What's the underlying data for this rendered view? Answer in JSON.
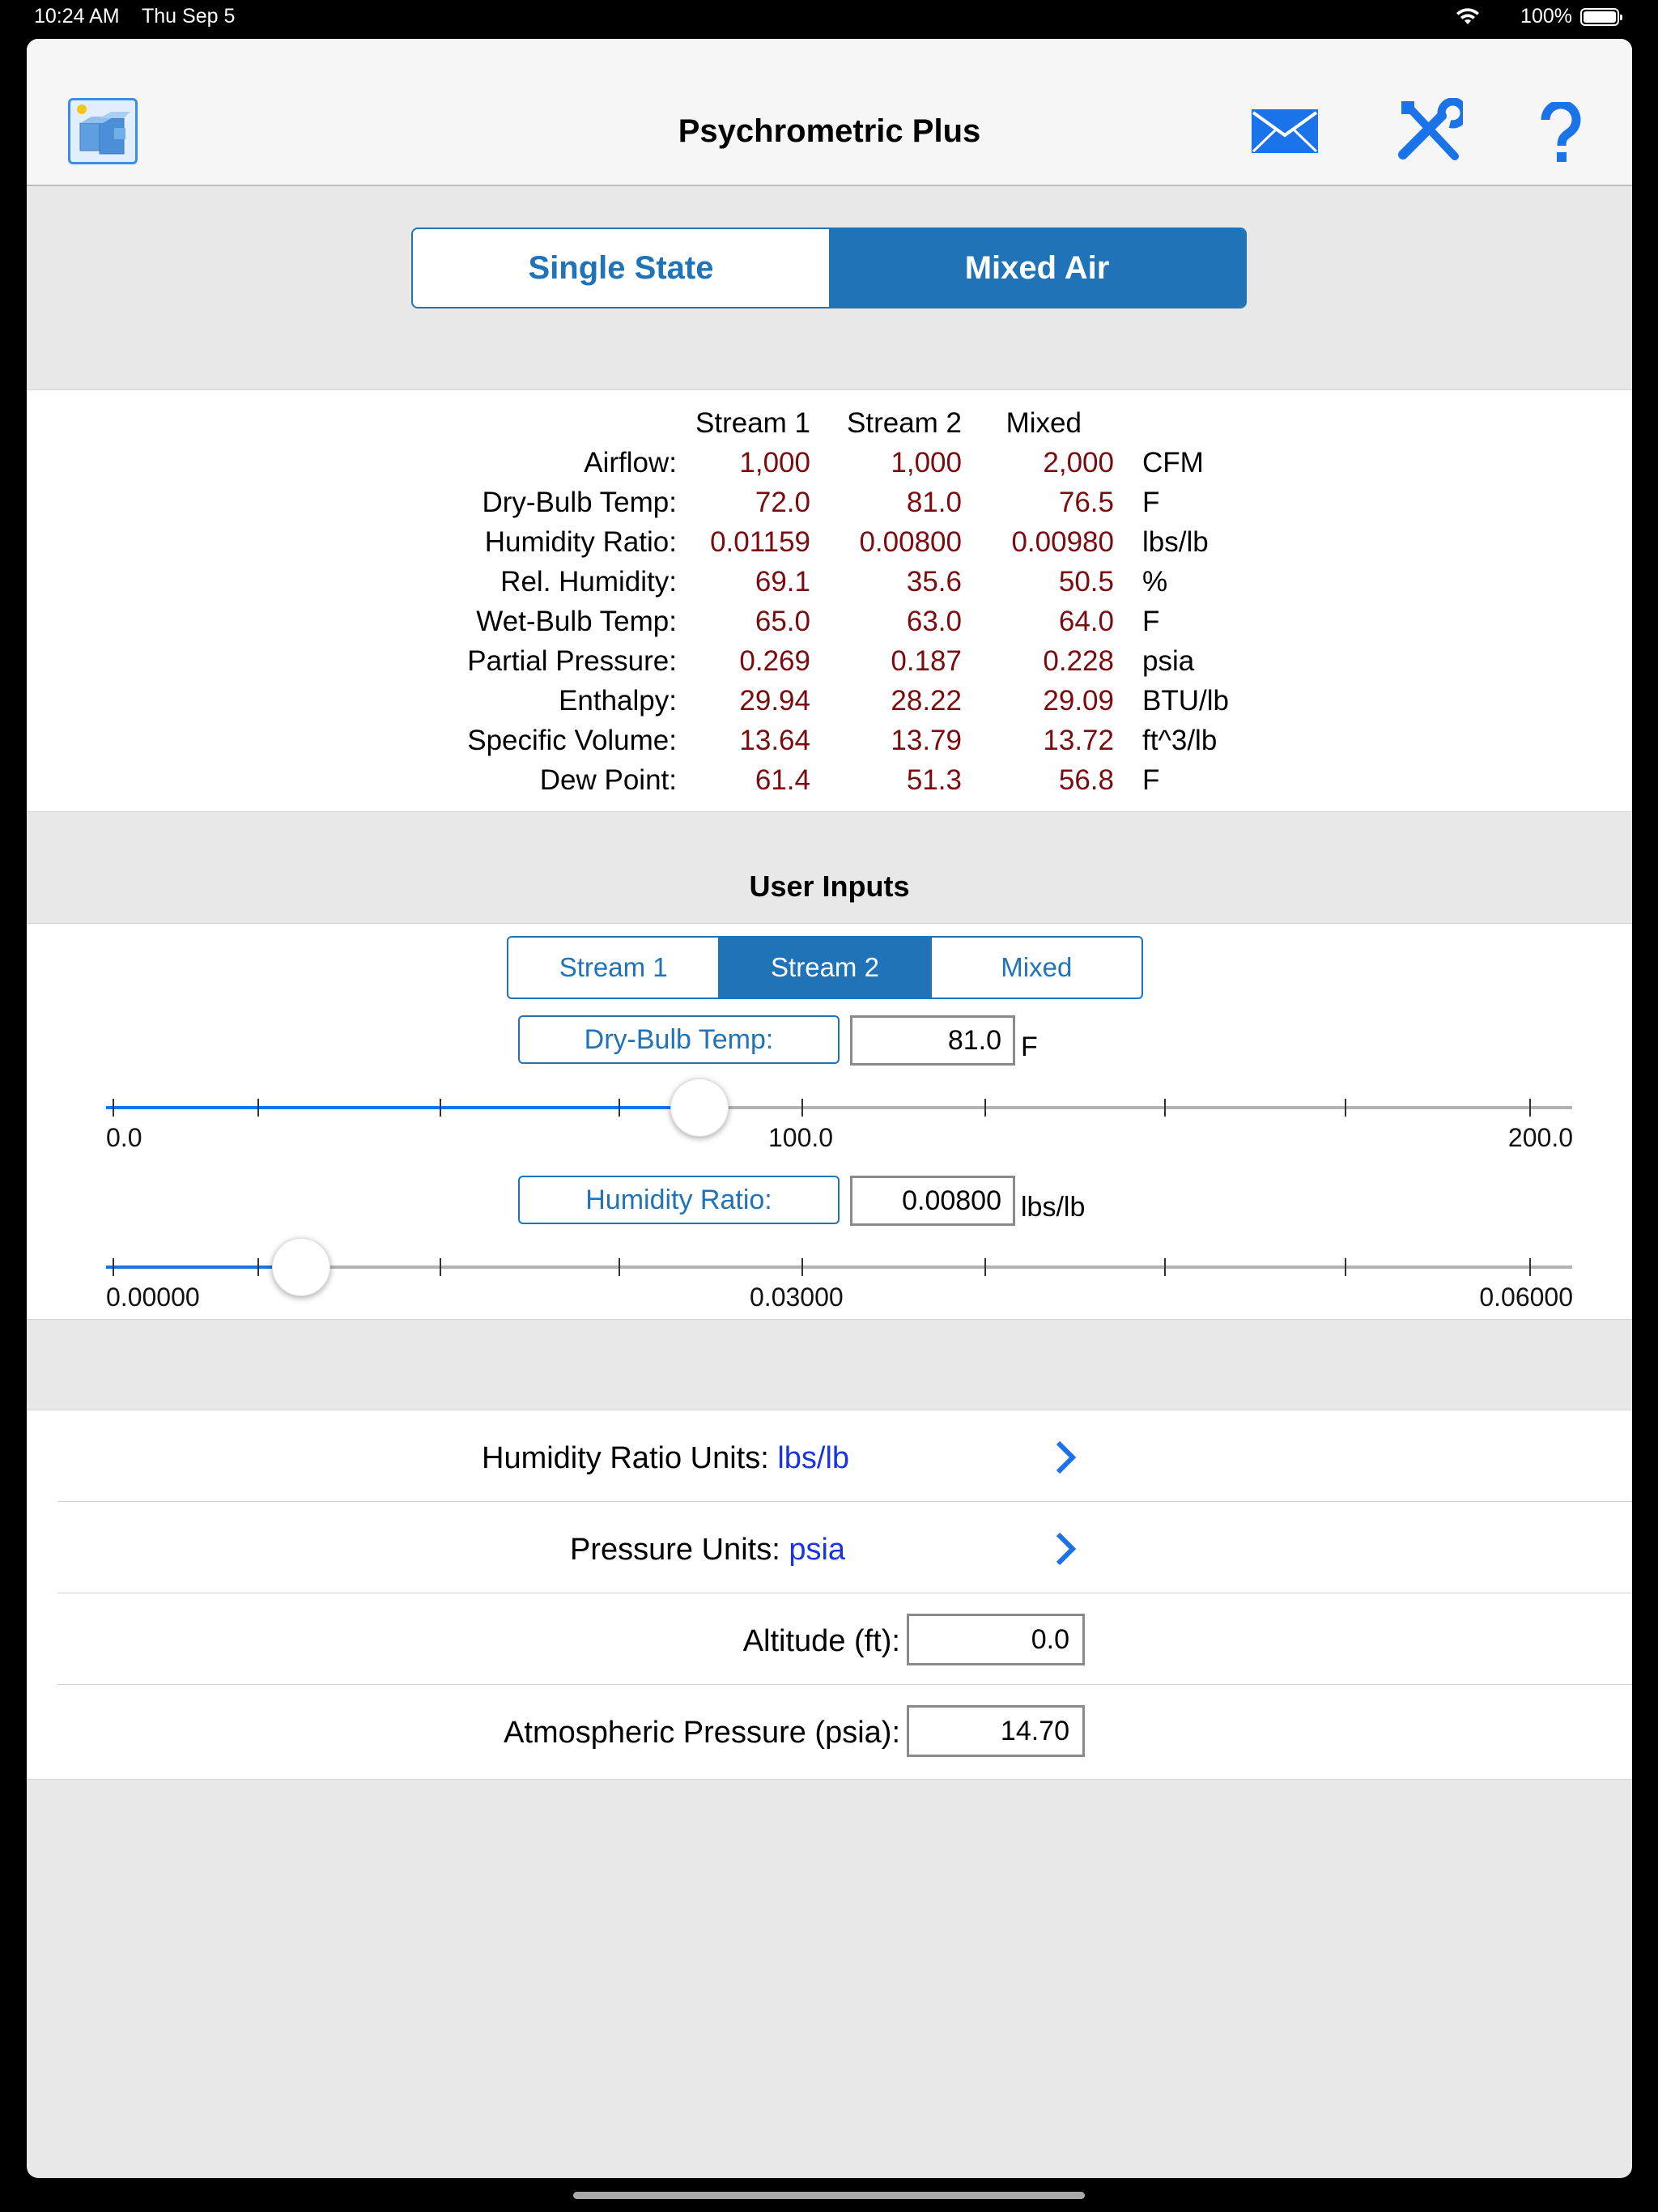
{
  "status": {
    "time": "10:24 AM",
    "date": "Thu Sep 5",
    "battery": "100%"
  },
  "nav": {
    "title": "Psychrometric Plus"
  },
  "mode_tabs": [
    {
      "label": "Single State"
    },
    {
      "label": "Mixed Air"
    }
  ],
  "results": {
    "headers": [
      "Stream 1",
      "Stream 2",
      "Mixed"
    ],
    "rows": [
      {
        "label": "Airflow:",
        "s1": "1,000",
        "s2": "1,000",
        "mixed": "2,000",
        "unit": "CFM"
      },
      {
        "label": "Dry-Bulb Temp:",
        "s1": "72.0",
        "s2": "81.0",
        "mixed": "76.5",
        "unit": "F"
      },
      {
        "label": "Humidity Ratio:",
        "s1": "0.01159",
        "s2": "0.00800",
        "mixed": "0.00980",
        "unit": "lbs/lb"
      },
      {
        "label": "Rel. Humidity:",
        "s1": "69.1",
        "s2": "35.6",
        "mixed": "50.5",
        "unit": "%"
      },
      {
        "label": "Wet-Bulb Temp:",
        "s1": "65.0",
        "s2": "63.0",
        "mixed": "64.0",
        "unit": "F"
      },
      {
        "label": "Partial Pressure:",
        "s1": "0.269",
        "s2": "0.187",
        "mixed": "0.228",
        "unit": "psia"
      },
      {
        "label": "Enthalpy:",
        "s1": "29.94",
        "s2": "28.22",
        "mixed": "29.09",
        "unit": "BTU/lb"
      },
      {
        "label": "Specific Volume:",
        "s1": "13.64",
        "s2": "13.79",
        "mixed": "13.72",
        "unit": "ft^3/lb"
      },
      {
        "label": "Dew Point:",
        "s1": "61.4",
        "s2": "51.3",
        "mixed": "56.8",
        "unit": "F"
      }
    ]
  },
  "user_inputs": {
    "title": "User Inputs",
    "stream_tabs": [
      {
        "label": "Stream 1"
      },
      {
        "label": "Stream 2"
      },
      {
        "label": "Mixed"
      }
    ],
    "dry_bulb": {
      "label": "Dry-Bulb Temp:",
      "value": "81.0",
      "unit": "F",
      "min_label": "0.0",
      "mid_label": "100.0",
      "max_label": "200.0",
      "min": 0,
      "max": 200,
      "current": 81
    },
    "humidity_ratio": {
      "label": "Humidity Ratio:",
      "value": "0.00800",
      "unit": "lbs/lb",
      "min_label": "0.00000",
      "mid_label": "0.03000",
      "max_label": "0.06000",
      "min": 0,
      "max": 0.06,
      "current": 0.008
    }
  },
  "settings": {
    "humidity_units": {
      "label": "Humidity Ratio Units:",
      "value": "lbs/lb"
    },
    "pressure_units": {
      "label": "Pressure Units:",
      "value": "psia"
    },
    "altitude": {
      "label": "Altitude (ft):",
      "value": "0.0"
    },
    "atm_pressure": {
      "label": "Atmospheric Pressure (psia):",
      "value": "14.70"
    }
  },
  "colors": {
    "accent": "#2073b7",
    "value_red": "#7a0c10",
    "link_blue": "#1a35e0",
    "icon_blue": "#1a73e8"
  }
}
